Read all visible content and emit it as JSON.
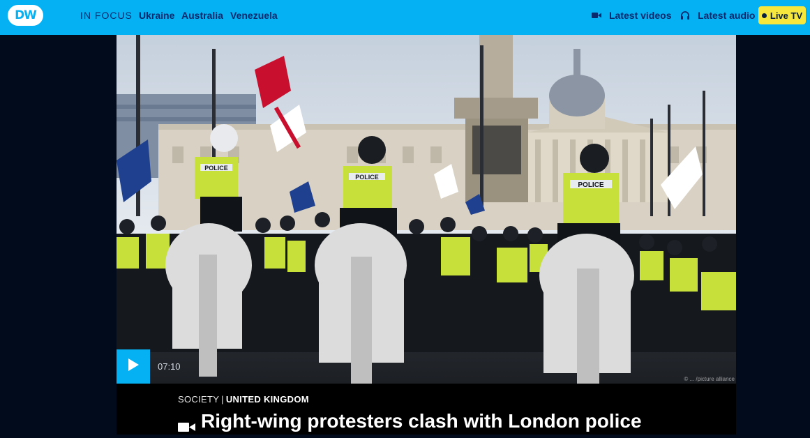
{
  "header": {
    "logo_text": "DW",
    "in_focus_label": "IN FOCUS",
    "focus_links": [
      "Ukraine",
      "Australia",
      "Venezuela"
    ],
    "latest_videos": "Latest videos",
    "latest_audio": "Latest audio",
    "live_tv": "Live TV"
  },
  "hero": {
    "duration": "07:10",
    "credit": "© ... /picture alliance",
    "police_label": "POLICE"
  },
  "article": {
    "category": "SOCIETY",
    "separator": "|",
    "subcategory": "UNITED KINGDOM",
    "headline": "Right-wing protesters clash with London police"
  },
  "icons": {
    "logo": "dw-logo",
    "video": "video-camera-icon",
    "audio": "headphones-icon",
    "live": "live-dot-icon",
    "play": "play-icon"
  },
  "colors": {
    "header_bg": "#05b1f2",
    "header_text": "#0a2a6e",
    "live_bg": "#f7e63b",
    "page_bg": "#020b1c",
    "caption_bg": "#000000"
  }
}
